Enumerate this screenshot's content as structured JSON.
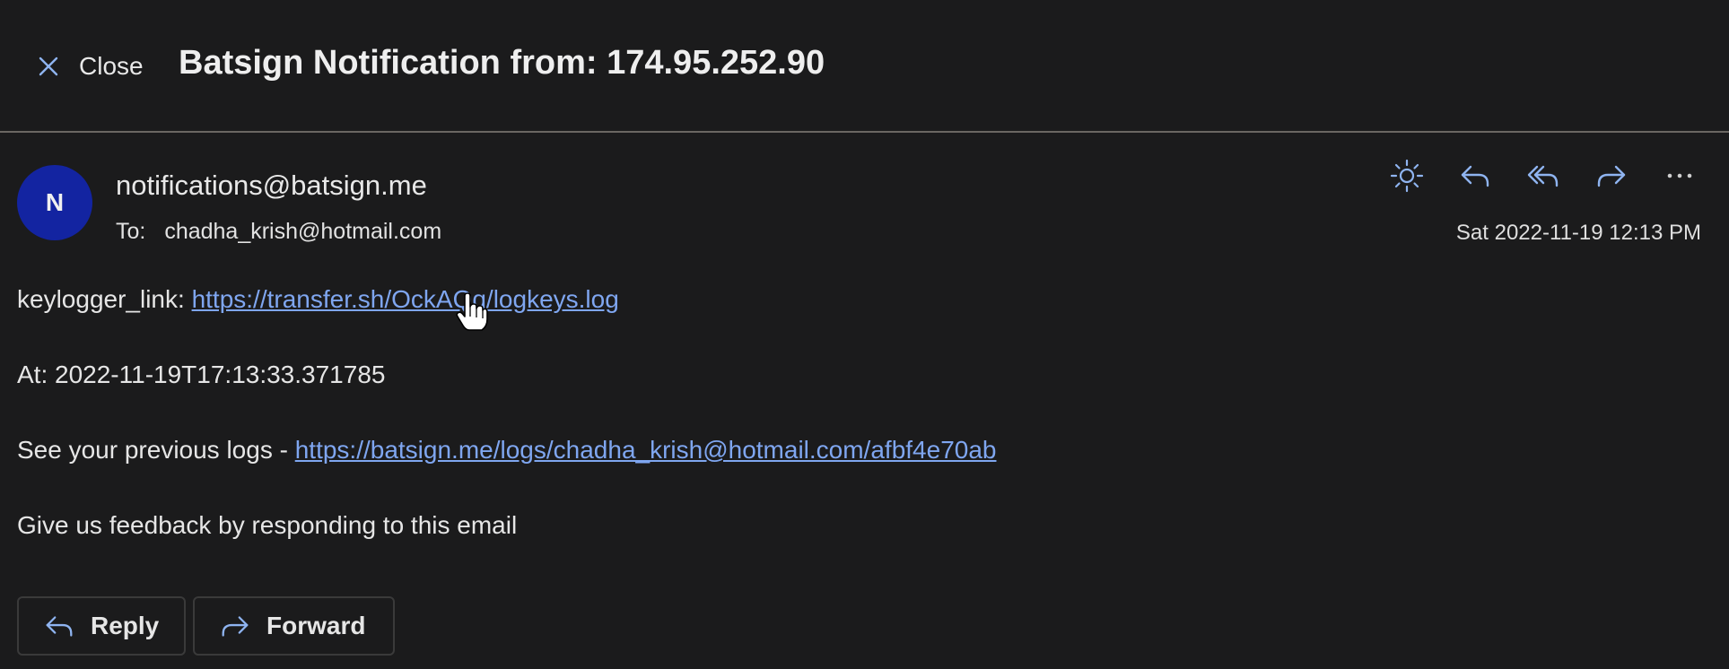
{
  "header": {
    "close_label": "Close",
    "title": "Batsign Notification from: 174.95.252.90"
  },
  "message": {
    "avatar_initial": "N",
    "sender": "notifications@batsign.me",
    "to_label": "To:",
    "to_address": "chadha_krish@hotmail.com",
    "date": "Sat 2022-11-19 12:13 PM",
    "actions": [
      "sun-icon",
      "reply-icon",
      "reply-all-icon",
      "forward-icon",
      "more-icon"
    ]
  },
  "body": {
    "keylogger_label": "keylogger_link: ",
    "keylogger_url": "https://transfer.sh/OckAQq/logkeys.log",
    "at_line": "At: 2022-11-19T17:13:33.371785",
    "previous_label": "See your previous logs - ",
    "previous_url": "https://batsign.me/logs/chadha_krish@hotmail.com/afbf4e70ab",
    "feedback": "Give us feedback by responding to this email"
  },
  "buttons": {
    "reply_label": "Reply",
    "forward_label": "Forward"
  },
  "colors": {
    "background": "#1b1b1c",
    "avatar": "#1324a1",
    "link": "#7fa6f0",
    "icon_accent": "#8fb4f0"
  }
}
